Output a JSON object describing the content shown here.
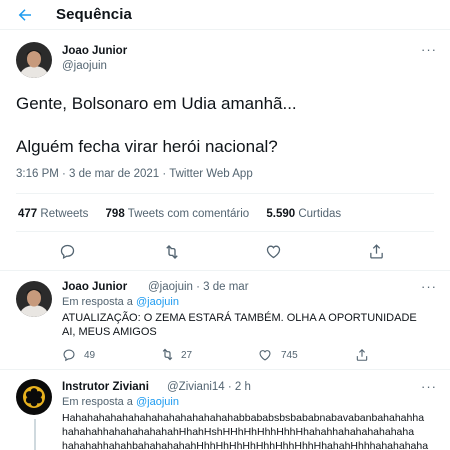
{
  "header": {
    "title": "Sequência"
  },
  "main_tweet": {
    "name": "Joao Junior",
    "handle": "@jaojuin",
    "line1": "Gente, Bolsonaro em Udia amanhã...",
    "line2": "Alguém fecha virar herói nacional?",
    "meta": "3:16 PM · 3 de mar de 2021 · Twitter Web App",
    "stats": [
      {
        "num": "477",
        "label": "Retweets"
      },
      {
        "num": "798",
        "label": "Tweets com comentário"
      },
      {
        "num": "5.590",
        "label": "Curtidas"
      }
    ]
  },
  "reply1": {
    "name": "Joao Junior",
    "handle_time": "@jaojuin · 3 de mar",
    "reply_prefix": "Em resposta a",
    "reply_handle": "@jaojuin",
    "body": "ATUALIZAÇÃO: O ZEMA ESTARÁ TAMBÉM. OLHA A OPORTUNIDADE AI, MEUS AMIGOS",
    "replies": "49",
    "retweets": "27",
    "likes": "745"
  },
  "reply2": {
    "name": "Instrutor Ziviani",
    "handle_time": "@Ziviani14 · 2 h",
    "reply_prefix": "Em resposta a",
    "reply_handle": "@jaojuin",
    "line1": "Hahahahahahahahahahahahahahahabbababsbsbababnabavabanbahahahha",
    "line2": "hahahahhahahahahahahHhahHshHHhHhHhhHhhHhahahhahahahahahaha",
    "line3": "hahahahhahahbahahahahahHhhHhHhHhHhhHhhHhhHhahahHhhhahahahaha"
  },
  "colors": {
    "accent": "#1d9bf0",
    "text": "#0f1419",
    "muted": "#536471"
  }
}
